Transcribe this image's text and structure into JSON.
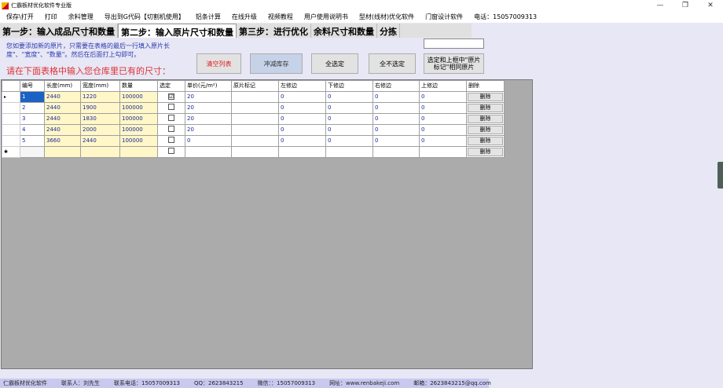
{
  "window": {
    "title": "仁霸板材优化软件专业版",
    "minimize": "—",
    "maximize": "❐",
    "close": "✕"
  },
  "menu": [
    "保存\\打开",
    "打印",
    "余料管理",
    "导出到G代码【切割机使用】",
    "铝条计算",
    "在线升级",
    "视频教程",
    "用户使用说明书",
    "型材(线材)优化软件",
    "门窗设计软件",
    "电话：15057009313"
  ],
  "tabs": [
    "第一步：输入成品尺寸和数量",
    "第二步：输入原片尺寸和数量",
    "第三步：进行优化",
    "余料尺寸和数量",
    "分拣"
  ],
  "active_tab": 1,
  "hint": "您如要添加新的原片，只需要在表格的最后一行填入原片长度\"、\"宽度\"、\"数量\"。然后在后面打上勾即可。",
  "red_hint": "请在下面表格中输入您仓库里已有的尺寸：",
  "buttons": {
    "clear": "清空列表",
    "deduct": "冲减库存",
    "select_all": "全选定",
    "select_none": "全不选定",
    "select_same": "选定和上框中\"原片标记\"相同原片"
  },
  "table": {
    "headers": [
      "编号",
      "长度(mm)",
      "宽度(mm)",
      "数量",
      "选定",
      "单价(元/m²)",
      "原片标记",
      "左修边",
      "下修边",
      "右修边",
      "上修边",
      "删除"
    ],
    "rows": [
      {
        "no": "1",
        "length": "2440",
        "width": "1220",
        "qty": "100000",
        "checked": "☑",
        "price": "20",
        "mark": "",
        "left": "0",
        "bottom": "0",
        "right": "0",
        "top": "0",
        "del": "删除"
      },
      {
        "no": "2",
        "length": "2440",
        "width": "1900",
        "qty": "100000",
        "checked": "",
        "price": "20",
        "mark": "",
        "left": "0",
        "bottom": "0",
        "right": "0",
        "top": "0",
        "del": "删除"
      },
      {
        "no": "3",
        "length": "2440",
        "width": "1830",
        "qty": "100000",
        "checked": "",
        "price": "20",
        "mark": "",
        "left": "0",
        "bottom": "0",
        "right": "0",
        "top": "0",
        "del": "删除"
      },
      {
        "no": "4",
        "length": "2440",
        "width": "2000",
        "qty": "100000",
        "checked": "",
        "price": "20",
        "mark": "",
        "left": "0",
        "bottom": "0",
        "right": "0",
        "top": "0",
        "del": "删除"
      },
      {
        "no": "5",
        "length": "3660",
        "width": "2440",
        "qty": "100000",
        "checked": "",
        "price": "0",
        "mark": "",
        "left": "0",
        "bottom": "0",
        "right": "0",
        "top": "0",
        "del": "删除"
      }
    ],
    "new_row_delete": "删除",
    "current_row_marker": "▸",
    "new_row_marker": "✱"
  },
  "status": [
    "仁霸板材优化软件",
    "联系人：刘先生",
    "联系电话：15057009313",
    "QQ：2623843215",
    "微信：：15057009313",
    "网址：www.renbakeji.com",
    "邮箱：2623843215@qq.com"
  ],
  "colors": {
    "accent_blue": "#1c62c4",
    "hint_red": "#e03030",
    "hint_blue": "#2b3ab0",
    "yellow_cells": "#fff7c8",
    "status_bar": "#c9c9f0"
  }
}
